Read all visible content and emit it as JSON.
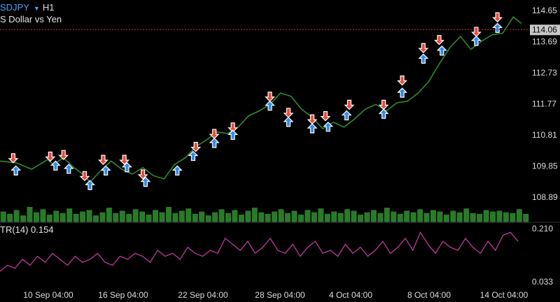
{
  "header": {
    "symbol": "SDJPY",
    "dropdown_glyph": "▼",
    "timeframe": "H1",
    "description": "S Dollar vs Yen"
  },
  "indicator": {
    "label": "TR(14) 0.154",
    "axis_top": "0.210",
    "axis_bottom": "0.033"
  },
  "colors": {
    "background": "#000000",
    "price_line": "#2e8b2e",
    "volume": "#2a7a2a",
    "indicator": "#c0399a",
    "current_price_line": "#d03030",
    "buy_arrow": "#2f8ae8",
    "sell_arrow": "#e84a3a",
    "price_tag_bg": "#c8c8c8"
  },
  "price_axis": {
    "labels": [
      "114.65",
      "113.69",
      "112.73",
      "111.77",
      "110.81",
      "109.85",
      "108.89"
    ],
    "current_price": "114.06"
  },
  "time_axis": {
    "labels": [
      "10 Sep 04:00",
      "16 Sep 04:00",
      "22 Sep 04:00",
      "28 Sep 04:00",
      "4 Oct 04:00",
      "8 Oct 04:00",
      "14 Oct 04:00"
    ]
  },
  "chart_data": {
    "type": "line",
    "ylim": [
      108.5,
      114.8
    ],
    "xlim": [
      0,
      100
    ],
    "ylabel": "",
    "xlabel": "",
    "series": [
      {
        "x": [
          0,
          3,
          6,
          9,
          10,
          12,
          14,
          16,
          17,
          19,
          21,
          23,
          25,
          27,
          29,
          31,
          33,
          35,
          37,
          39,
          41,
          43,
          45,
          47,
          49,
          51,
          53,
          55,
          57,
          59,
          61,
          63,
          65,
          67,
          69,
          71,
          73,
          75,
          77,
          79,
          81,
          83,
          85,
          87,
          89,
          91,
          93,
          95,
          97,
          98.5
        ],
        "values": [
          110.0,
          109.95,
          109.75,
          110.05,
          109.9,
          110.1,
          109.8,
          109.55,
          109.35,
          109.7,
          110.0,
          109.75,
          109.6,
          109.8,
          109.55,
          109.45,
          109.9,
          110.1,
          110.45,
          110.65,
          110.9,
          110.85,
          111.05,
          111.4,
          111.55,
          111.75,
          112.1,
          112.0,
          111.6,
          111.35,
          111.0,
          111.2,
          111.05,
          111.3,
          111.6,
          111.75,
          111.55,
          111.8,
          111.85,
          112.1,
          112.45,
          113.0,
          113.5,
          113.85,
          113.45,
          113.7,
          113.9,
          113.95,
          114.45,
          114.25
        ]
      }
    ],
    "volume": [
      14,
      11,
      16,
      9,
      20,
      13,
      17,
      10,
      15,
      12,
      18,
      11,
      14,
      16,
      9,
      13,
      19,
      12,
      15,
      11,
      17,
      14,
      10,
      16,
      13,
      20,
      12,
      15,
      18,
      11,
      14,
      9,
      13,
      17,
      12,
      16,
      10,
      15,
      19,
      13,
      11,
      14,
      17,
      12,
      15,
      10,
      16,
      13,
      18,
      11,
      14,
      12,
      17,
      15,
      10,
      13,
      16,
      12,
      19,
      14,
      11,
      15,
      13,
      17,
      12,
      16,
      14,
      10,
      15,
      13,
      18,
      12,
      11,
      16,
      14,
      15,
      13,
      12,
      17,
      11
    ],
    "indicator_values": [
      0.07,
      0.09,
      0.08,
      0.11,
      0.09,
      0.12,
      0.1,
      0.13,
      0.11,
      0.09,
      0.12,
      0.1,
      0.11,
      0.13,
      0.1,
      0.09,
      0.12,
      0.11,
      0.13,
      0.12,
      0.1,
      0.14,
      0.12,
      0.13,
      0.11,
      0.15,
      0.13,
      0.12,
      0.14,
      0.13,
      0.18,
      0.16,
      0.14,
      0.17,
      0.13,
      0.15,
      0.18,
      0.14,
      0.13,
      0.16,
      0.12,
      0.15,
      0.17,
      0.13,
      0.14,
      0.12,
      0.16,
      0.13,
      0.15,
      0.12,
      0.14,
      0.17,
      0.13,
      0.15,
      0.18,
      0.14,
      0.2,
      0.16,
      0.13,
      0.17,
      0.15,
      0.14,
      0.18,
      0.15,
      0.13,
      0.17,
      0.14,
      0.19,
      0.2,
      0.17
    ]
  },
  "markers": [
    {
      "x": 2.5,
      "y": 110.1,
      "type": "sell"
    },
    {
      "x": 3.0,
      "y": 109.7,
      "type": "buy"
    },
    {
      "x": 9.5,
      "y": 110.15,
      "type": "sell"
    },
    {
      "x": 10.5,
      "y": 109.85,
      "type": "buy"
    },
    {
      "x": 12.0,
      "y": 110.2,
      "type": "sell"
    },
    {
      "x": 13.0,
      "y": 109.75,
      "type": "buy"
    },
    {
      "x": 16.0,
      "y": 109.55,
      "type": "sell"
    },
    {
      "x": 17.0,
      "y": 109.25,
      "type": "buy"
    },
    {
      "x": 19.5,
      "y": 110.05,
      "type": "sell"
    },
    {
      "x": 20.0,
      "y": 109.7,
      "type": "buy"
    },
    {
      "x": 23.5,
      "y": 110.05,
      "type": "sell"
    },
    {
      "x": 24.0,
      "y": 109.8,
      "type": "buy"
    },
    {
      "x": 27.0,
      "y": 109.6,
      "type": "sell"
    },
    {
      "x": 27.5,
      "y": 109.35,
      "type": "buy"
    },
    {
      "x": 33.5,
      "y": 109.7,
      "type": "buy"
    },
    {
      "x": 37.0,
      "y": 110.45,
      "type": "sell"
    },
    {
      "x": 36.5,
      "y": 110.15,
      "type": "buy"
    },
    {
      "x": 40.5,
      "y": 110.85,
      "type": "sell"
    },
    {
      "x": 40.5,
      "y": 110.55,
      "type": "buy"
    },
    {
      "x": 44.0,
      "y": 111.05,
      "type": "sell"
    },
    {
      "x": 44.0,
      "y": 110.8,
      "type": "buy"
    },
    {
      "x": 51.0,
      "y": 112.0,
      "type": "sell"
    },
    {
      "x": 51.0,
      "y": 111.7,
      "type": "buy"
    },
    {
      "x": 54.5,
      "y": 111.5,
      "type": "sell"
    },
    {
      "x": 54.5,
      "y": 111.2,
      "type": "buy"
    },
    {
      "x": 59.0,
      "y": 111.3,
      "type": "sell"
    },
    {
      "x": 59.0,
      "y": 111.0,
      "type": "buy"
    },
    {
      "x": 61.5,
      "y": 111.4,
      "type": "sell"
    },
    {
      "x": 62.0,
      "y": 111.05,
      "type": "buy"
    },
    {
      "x": 66.0,
      "y": 111.75,
      "type": "sell"
    },
    {
      "x": 65.5,
      "y": 111.4,
      "type": "buy"
    },
    {
      "x": 72.5,
      "y": 111.75,
      "type": "sell"
    },
    {
      "x": 72.5,
      "y": 111.45,
      "type": "buy"
    },
    {
      "x": 76.0,
      "y": 112.5,
      "type": "sell"
    },
    {
      "x": 76.0,
      "y": 112.1,
      "type": "buy"
    },
    {
      "x": 80.0,
      "y": 113.5,
      "type": "sell"
    },
    {
      "x": 80.0,
      "y": 113.15,
      "type": "buy"
    },
    {
      "x": 83.0,
      "y": 113.75,
      "type": "sell"
    },
    {
      "x": 83.5,
      "y": 113.4,
      "type": "buy"
    },
    {
      "x": 90.0,
      "y": 114.0,
      "type": "sell"
    },
    {
      "x": 90.0,
      "y": 113.7,
      "type": "buy"
    },
    {
      "x": 94.0,
      "y": 114.45,
      "type": "sell"
    },
    {
      "x": 94.0,
      "y": 114.1,
      "type": "buy"
    }
  ]
}
